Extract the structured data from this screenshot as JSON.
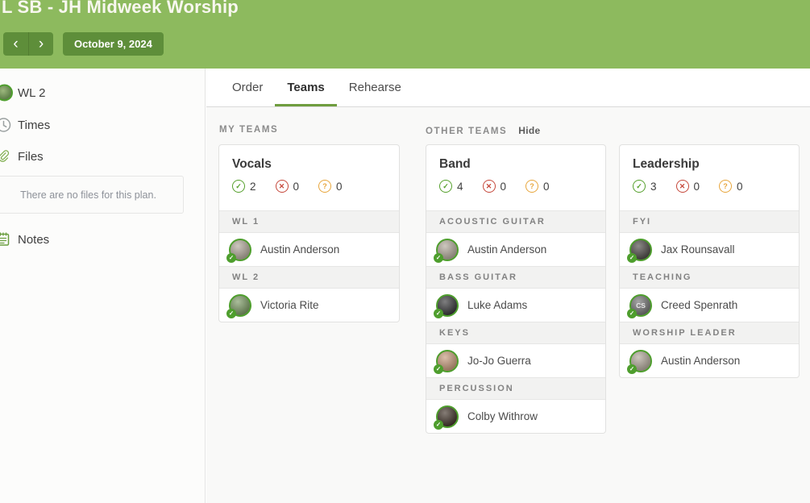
{
  "header": {
    "title": "L SB - JH Midweek Worship",
    "date_label": "October 9, 2024"
  },
  "icons": {
    "prev": "‹",
    "next": "›",
    "check": "✓",
    "cross": "✕",
    "question": "?"
  },
  "colors": {
    "header_bg": "#8dba5e",
    "header_button_bg": "#5e8e3a",
    "active_tab_underline": "#6f9d3f",
    "confirmed": "#55a02c",
    "declined": "#c5473a",
    "unconfirmed": "#e8a63c",
    "avatar_ring": "#4e9e2d"
  },
  "sidebar": {
    "plan_person_label": "WL 2",
    "times_label": "Times",
    "files_label": "Files",
    "files_empty_text": "There are no files for this plan.",
    "notes_label": "Notes"
  },
  "tabs": {
    "order": "Order",
    "teams": "Teams",
    "rehearse": "Rehearse",
    "active": "Teams"
  },
  "teams_page": {
    "my_teams_label": "MY TEAMS",
    "other_teams_label": "OTHER TEAMS",
    "hide_label": "Hide",
    "cards": [
      {
        "name": "Vocals",
        "confirmed": "2",
        "declined": "0",
        "unconfirmed": "0",
        "sections": [
          {
            "label": "WL 1",
            "members": [
              {
                "name": "Austin Anderson",
                "avatar_color": "#b3aa9c"
              }
            ]
          },
          {
            "label": "WL 2",
            "members": [
              {
                "name": "Victoria Rite",
                "avatar_color": "#7d9a66"
              }
            ]
          }
        ]
      },
      {
        "name": "Band",
        "confirmed": "4",
        "declined": "0",
        "unconfirmed": "0",
        "sections": [
          {
            "label": "ACOUSTIC GUITAR",
            "members": [
              {
                "name": "Austin Anderson",
                "avatar_color": "#b3aa9c"
              }
            ]
          },
          {
            "label": "BASS GUITAR",
            "members": [
              {
                "name": "Luke Adams",
                "avatar_color": "#3a3a3c"
              }
            ]
          },
          {
            "label": "KEYS",
            "members": [
              {
                "name": "Jo-Jo Guerra",
                "avatar_color": "#c79b7d"
              }
            ]
          },
          {
            "label": "PERCUSSION",
            "members": [
              {
                "name": "Colby Withrow",
                "avatar_color": "#44372d"
              }
            ]
          }
        ]
      },
      {
        "name": "Leadership",
        "confirmed": "3",
        "declined": "0",
        "unconfirmed": "0",
        "sections": [
          {
            "label": "FYI",
            "members": [
              {
                "name": "Jax Rounsavall",
                "avatar_color": "#504d49"
              }
            ]
          },
          {
            "label": "TEACHING",
            "members": [
              {
                "name": "Creed Spenrath",
                "avatar_color": "#757575",
                "initials": "CS"
              }
            ]
          },
          {
            "label": "WORSHIP LEADER",
            "members": [
              {
                "name": "Austin Anderson",
                "avatar_color": "#b3aa9c"
              }
            ]
          }
        ]
      }
    ]
  }
}
